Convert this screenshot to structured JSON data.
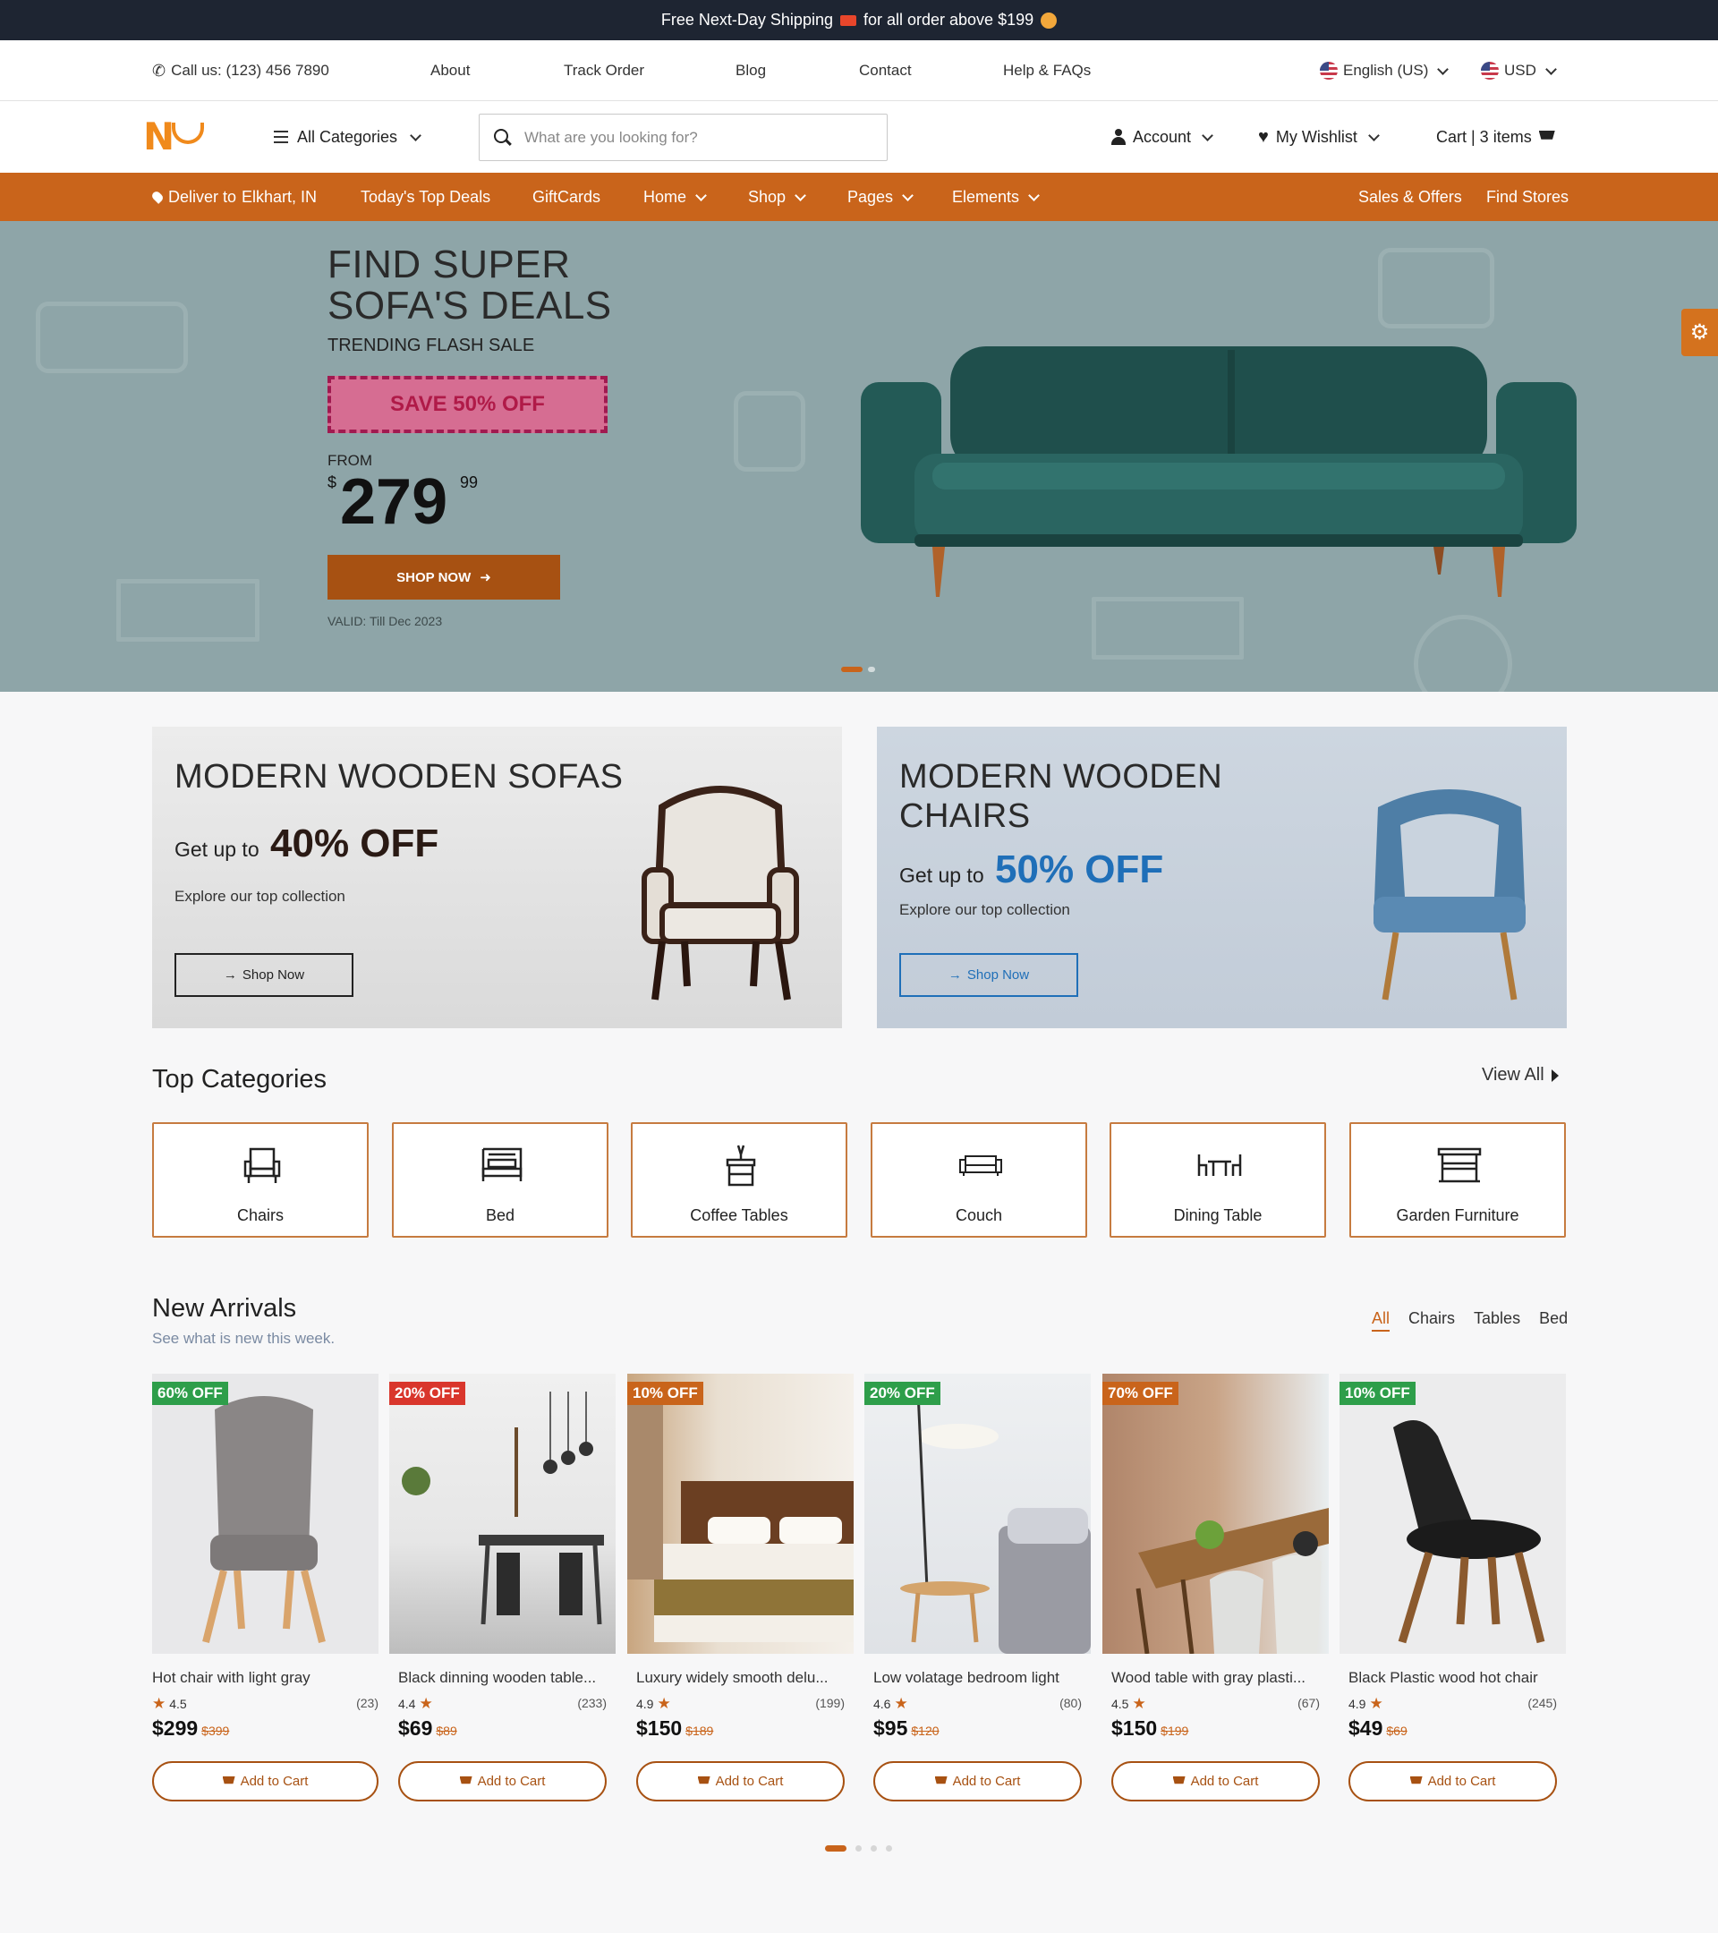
{
  "topbar": {
    "text_before": "Free Next-Day Shipping",
    "text_after": "for all order above $199"
  },
  "utility": {
    "call": "Call us: (123) 456 7890",
    "links": [
      "About",
      "Track Order",
      "Blog",
      "Contact",
      "Help & FAQs"
    ],
    "language": "English (US)",
    "currency": "USD"
  },
  "header": {
    "all_categories": "All Categories",
    "search_placeholder": "What are you looking for?",
    "account": "Account",
    "wishlist": "My Wishlist",
    "cart": "Cart | 3 items"
  },
  "nav": {
    "deliver_prefix": "Deliver to",
    "deliver_location": "Elkhart, IN",
    "items": [
      "Today's Top Deals",
      "GiftCards",
      "Home",
      "Shop",
      "Pages",
      "Elements"
    ],
    "right": [
      "Sales & Offers",
      "Find Stores"
    ]
  },
  "hero": {
    "title_line1": "FIND SUPER",
    "title_line2": "SOFA'S DEALS",
    "subtitle": "TRENDING FLASH SALE",
    "badge": "SAVE 50% OFF",
    "from": "FROM",
    "currency": "$",
    "price": "279",
    "cents": "99",
    "button": "SHOP NOW",
    "valid": "VALID: Till Dec 2023",
    "slide_index": 1,
    "slide_count": 2
  },
  "promos": [
    {
      "title": "MODERN WOODEN SOFAS",
      "get": "Get up to",
      "discount": "40% OFF",
      "explore": "Explore our top collection",
      "button": "Shop Now",
      "accent": "#2a1a14"
    },
    {
      "title_line1": "MODERN WOODEN",
      "title_line2": "CHAIRS",
      "get": "Get up to",
      "discount": "50% OFF",
      "explore": "Explore our top collection",
      "button": "Shop Now",
      "accent": "#1f6fb8"
    }
  ],
  "categories": {
    "title": "Top Categories",
    "view_all": "View All",
    "items": [
      {
        "label": "Chairs",
        "icon": "chair-icon"
      },
      {
        "label": "Bed",
        "icon": "bed-icon"
      },
      {
        "label": "Coffee Tables",
        "icon": "coffee-table-icon"
      },
      {
        "label": "Couch",
        "icon": "couch-icon"
      },
      {
        "label": "Dining Table",
        "icon": "dining-table-icon"
      },
      {
        "label": "Garden Furniture",
        "icon": "garden-furniture-icon"
      }
    ]
  },
  "arrivals": {
    "title": "New Arrivals",
    "subtitle": "See what is new this week.",
    "filters": [
      "All",
      "Chairs",
      "Tables",
      "Bed"
    ],
    "active_filter": "All",
    "add_label": "Add to Cart",
    "products": [
      {
        "badge": "60% OFF",
        "badge_color": "#2e9e4a",
        "name": "Hot chair with light gray",
        "rating": "4.5",
        "reviews": "(23)",
        "price": "$299",
        "old": "$399"
      },
      {
        "badge": "20% OFF",
        "badge_color": "#d9362c",
        "name": "Black dinning wooden table...",
        "rating": "4.4",
        "reviews": "(233)",
        "price": "$69",
        "old": "$89"
      },
      {
        "badge": "10% OFF",
        "badge_color": "#c9641b",
        "name": "Luxury widely smooth delu...",
        "rating": "4.9",
        "reviews": "(199)",
        "price": "$150",
        "old": "$189"
      },
      {
        "badge": "20% OFF",
        "badge_color": "#2e9e4a",
        "name": "Low volatage bedroom light",
        "rating": "4.6",
        "reviews": "(80)",
        "price": "$95",
        "old": "$120"
      },
      {
        "badge": "70% OFF",
        "badge_color": "#c9641b",
        "name": "Wood table with gray plasti...",
        "rating": "4.5",
        "reviews": "(67)",
        "price": "$150",
        "old": "$199"
      },
      {
        "badge": "10% OFF",
        "badge_color": "#2e9e4a",
        "name": "Black Plastic wood hot chair",
        "rating": "4.9",
        "reviews": "(245)",
        "price": "$49",
        "old": "$69"
      }
    ],
    "page_index": 1,
    "page_count": 4
  },
  "colors": {
    "accent": "#c9641b",
    "dark": "#1e2532",
    "hero_bg": "#8ea5a8"
  }
}
